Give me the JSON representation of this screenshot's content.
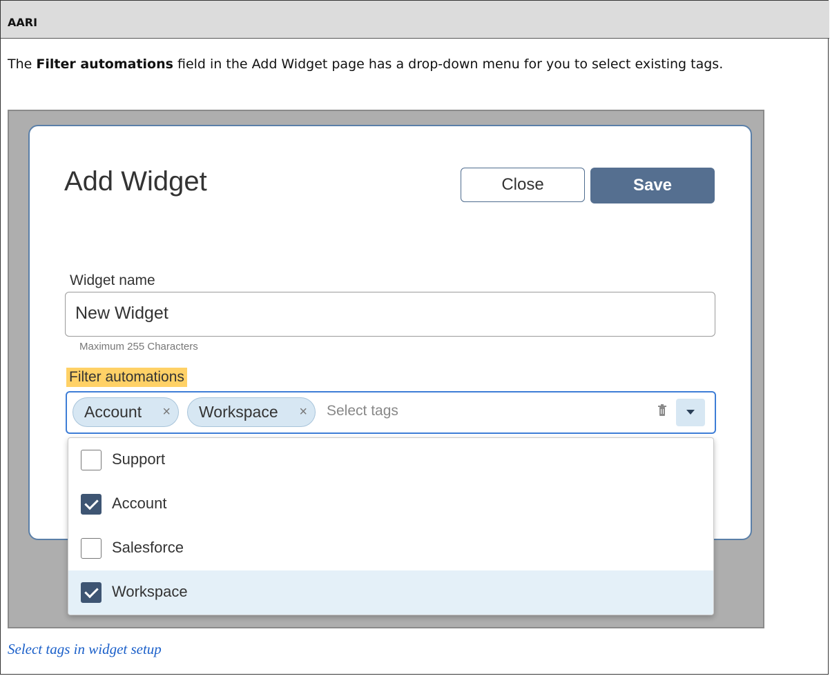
{
  "header": {
    "title": "AARI"
  },
  "description": {
    "prefix": "The ",
    "bold": "Filter automations",
    "suffix": " field in the Add Widget page has a drop-down menu for you to select existing tags."
  },
  "dialog": {
    "title": "Add Widget",
    "close_label": "Close",
    "save_label": "Save",
    "widget_name_label": "Widget name",
    "widget_name_value": "New Widget",
    "widget_name_hint": "Maximum 255 Characters",
    "filter_label": "Filter automations",
    "filter_placeholder": "Select tags",
    "selected_tags": [
      {
        "label": "Account",
        "remove_icon": "×"
      },
      {
        "label": "Workspace",
        "remove_icon": "×"
      }
    ],
    "options": [
      {
        "label": "Support",
        "checked": false
      },
      {
        "label": "Account",
        "checked": true
      },
      {
        "label": "Salesforce",
        "checked": false
      },
      {
        "label": "Workspace",
        "checked": true
      }
    ]
  },
  "caption": "Select tags in widget setup",
  "colors": {
    "highlight": "#ffd166",
    "save_button": "#556f90",
    "focus_border": "#3d7dd6",
    "chip_bg": "#d7e7f3",
    "caption_link": "#1a5fc9"
  }
}
